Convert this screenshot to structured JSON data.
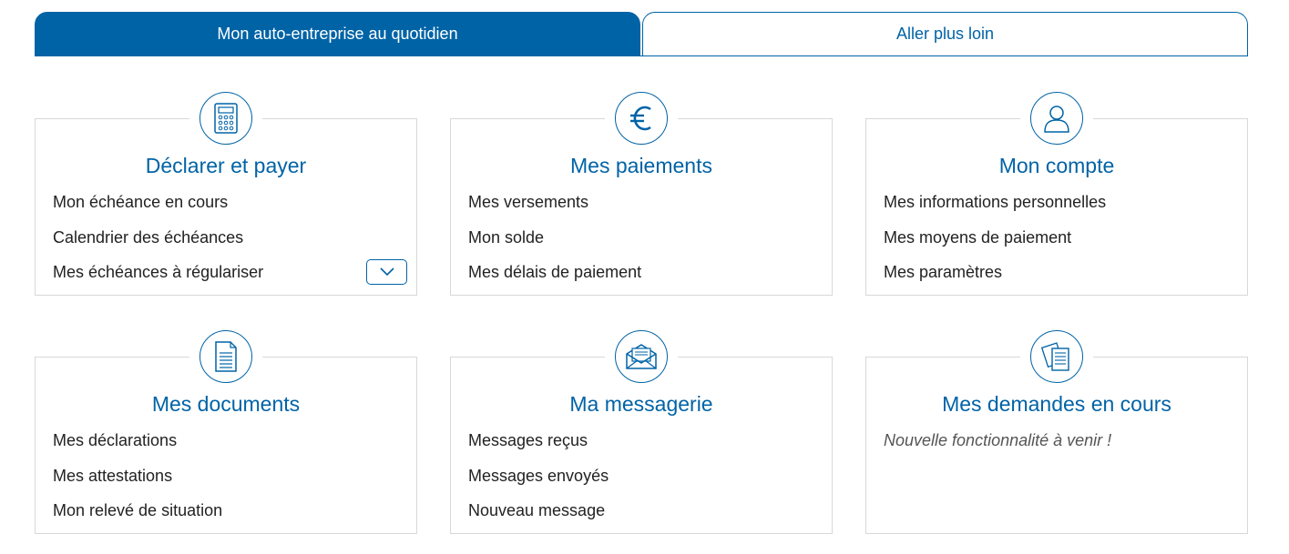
{
  "tabs": [
    {
      "label": "Mon auto-entreprise au quotidien",
      "active": true
    },
    {
      "label": "Aller plus loin",
      "active": false
    }
  ],
  "colors": {
    "accent": "#0063a6",
    "border": "#d8d8d8",
    "text": "#222222"
  },
  "cards": [
    {
      "icon": "calculator-icon",
      "title": "Déclarer et payer",
      "links": [
        "Mon échéance en cours",
        "Calendrier des échéances",
        "Mes échéances à régulariser"
      ],
      "expand_icon": "chevron-down-icon"
    },
    {
      "icon": "euro-icon",
      "title": "Mes paiements",
      "links": [
        "Mes versements",
        "Mon solde",
        "Mes délais de paiement"
      ]
    },
    {
      "icon": "user-icon",
      "title": "Mon compte",
      "links": [
        "Mes informations personnelles",
        "Mes moyens de paiement",
        "Mes paramètres"
      ]
    },
    {
      "icon": "document-icon",
      "title": "Mes documents",
      "links": [
        "Mes déclarations",
        "Mes attestations",
        "Mon relevé de situation"
      ]
    },
    {
      "icon": "envelope-icon",
      "title": "Ma messagerie",
      "links": [
        "Messages reçus",
        "Messages envoyés",
        "Nouveau message"
      ]
    },
    {
      "icon": "papers-icon",
      "title": "Mes demandes en cours",
      "note": "Nouvelle fonctionnalité à venir !"
    }
  ]
}
